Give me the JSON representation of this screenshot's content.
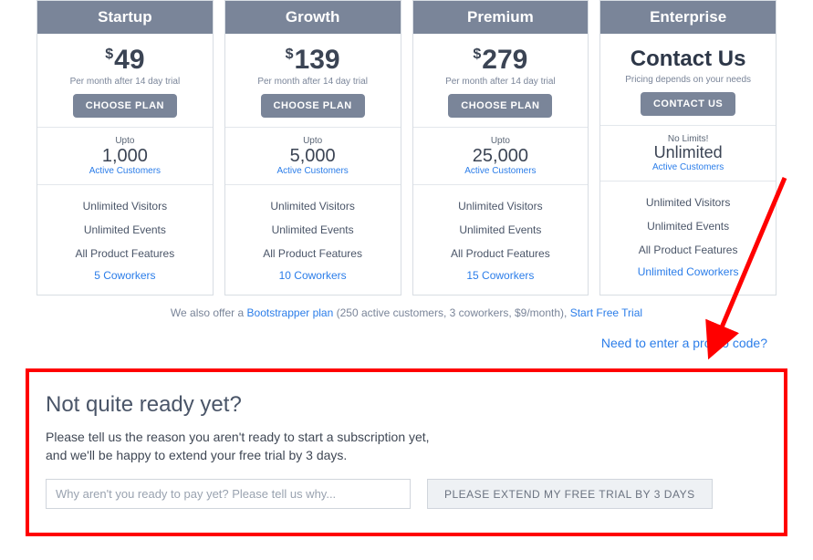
{
  "plans": [
    {
      "name": "Startup",
      "price": "49",
      "currency": "$",
      "sub": "Per month after 14 day trial",
      "cta": "CHOOSE PLAN",
      "cust_pre": "Upto",
      "cust_num": "1,000",
      "cust_link": "Active Customers",
      "features": [
        "Unlimited Visitors",
        "Unlimited Events",
        "All Product Features"
      ],
      "coworkers": "5 Coworkers"
    },
    {
      "name": "Growth",
      "price": "139",
      "currency": "$",
      "sub": "Per month after 14 day trial",
      "cta": "CHOOSE PLAN",
      "cust_pre": "Upto",
      "cust_num": "5,000",
      "cust_link": "Active Customers",
      "features": [
        "Unlimited Visitors",
        "Unlimited Events",
        "All Product Features"
      ],
      "coworkers": "10 Coworkers"
    },
    {
      "name": "Premium",
      "price": "279",
      "currency": "$",
      "sub": "Per month after 14 day trial",
      "cta": "CHOOSE PLAN",
      "cust_pre": "Upto",
      "cust_num": "25,000",
      "cust_link": "Active Customers",
      "features": [
        "Unlimited Visitors",
        "Unlimited Events",
        "All Product Features"
      ],
      "coworkers": "15 Coworkers"
    },
    {
      "name": "Enterprise",
      "contact_label": "Contact Us",
      "sub": "Pricing depends on your needs",
      "cta": "CONTACT US",
      "cust_pre": "No Limits!",
      "cust_num": "Unlimited",
      "cust_link": "Active Customers",
      "features": [
        "Unlimited Visitors",
        "Unlimited Events",
        "All Product Features"
      ],
      "coworkers": "Unlimited Coworkers"
    }
  ],
  "bootstrap": {
    "prefix": "We also offer a ",
    "link1": "Bootstrapper plan",
    "middle": " (250 active customers, 3 coworkers, $9/month), ",
    "link2": "Start Free Trial"
  },
  "promo": {
    "text": "Need to enter a promo code?"
  },
  "ready": {
    "title": "Not quite ready yet?",
    "sub": "Please tell us the reason you aren't ready to start a subscription yet, and we'll be happy to extend your free trial by 3 days.",
    "placeholder": "Why aren't you ready to pay yet? Please tell us why...",
    "button": "PLEASE EXTEND MY FREE TRIAL BY 3 DAYS"
  }
}
